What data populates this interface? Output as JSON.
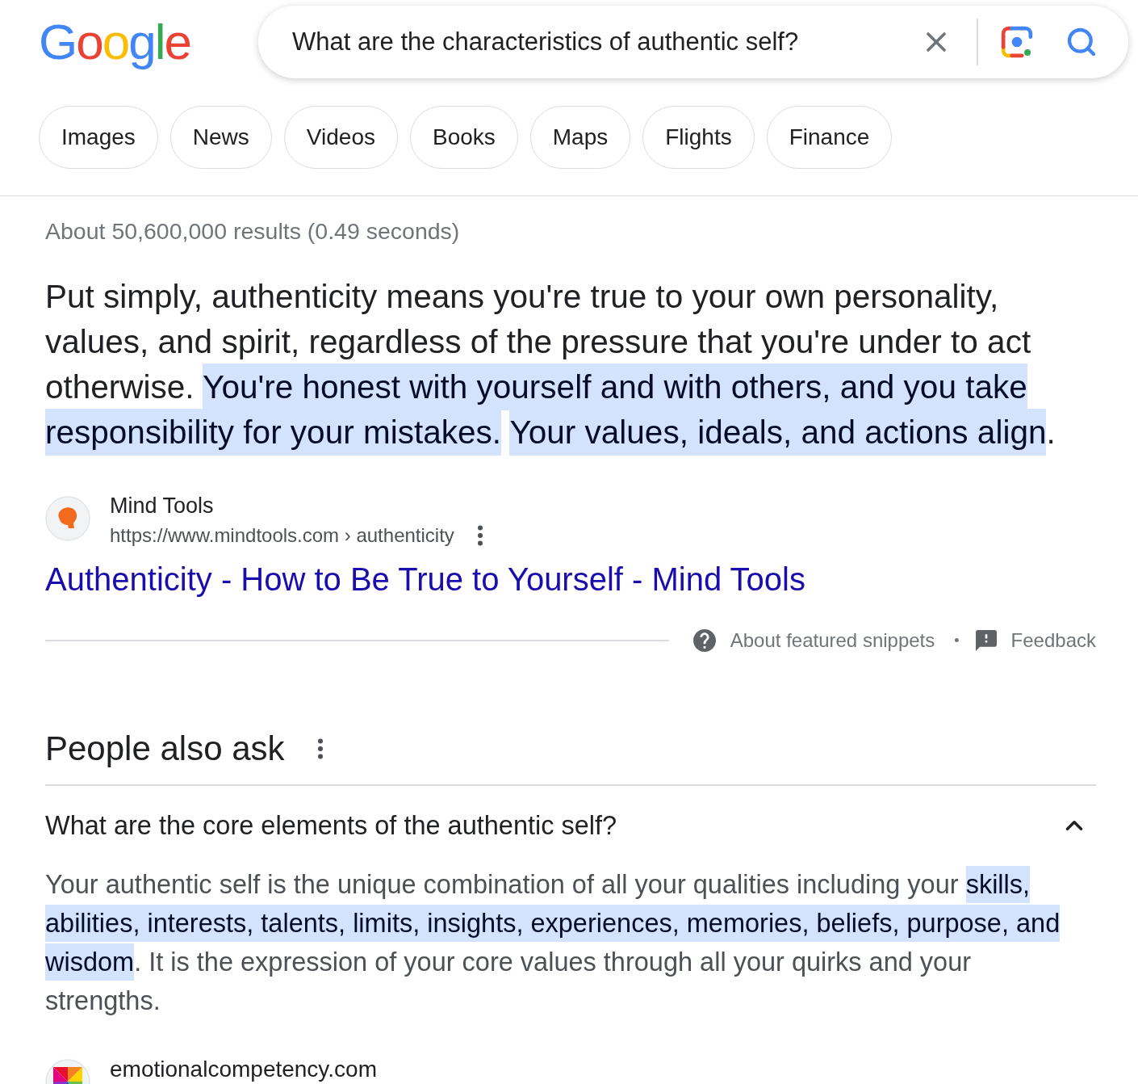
{
  "logo": "Google",
  "search": {
    "value": "What are the characteristics of authentic self?"
  },
  "filters": [
    "Images",
    "News",
    "Videos",
    "Books",
    "Maps",
    "Flights",
    "Finance"
  ],
  "result_stats": "About 50,600,000 results (0.49 seconds)",
  "featured_snippet": {
    "segments": [
      {
        "text": "Put simply, authenticity means you're true to your own personality, values, and spirit, regardless of the pressure that you're under to act otherwise. ",
        "highlighted": false
      },
      {
        "text": "You're honest with yourself and with others, and you take responsibility for your mistakes.",
        "highlighted": true
      },
      {
        "text": "Your values, ideals, and actions align",
        "highlighted": true
      },
      {
        "text": ".",
        "highlighted": false
      }
    ],
    "source": {
      "site_name": "Mind Tools",
      "url": "https://www.mindtools.com › authenticity",
      "title": "Authenticity - How to Be True to Yourself - Mind Tools"
    },
    "footer": {
      "about": "About featured snippets",
      "separator": "•",
      "feedback": "Feedback"
    }
  },
  "people_also_ask": {
    "heading": "People also ask",
    "questions": [
      {
        "question": "What are the core elements of the authentic self?",
        "expanded": true,
        "answer": [
          {
            "text": "Your authentic self is the unique combination of all your qualities including your ",
            "highlighted": false
          },
          {
            "text": "skills, abilities, interests, talents, limits, insights, experiences, memories, beliefs, purpose, and wisdom",
            "highlighted": true
          },
          {
            "text": ". It is the expression of your core values through all your quirks and your strengths.",
            "highlighted": false
          }
        ],
        "source": {
          "site_name": "emotionalcompetency.com"
        }
      }
    ]
  }
}
